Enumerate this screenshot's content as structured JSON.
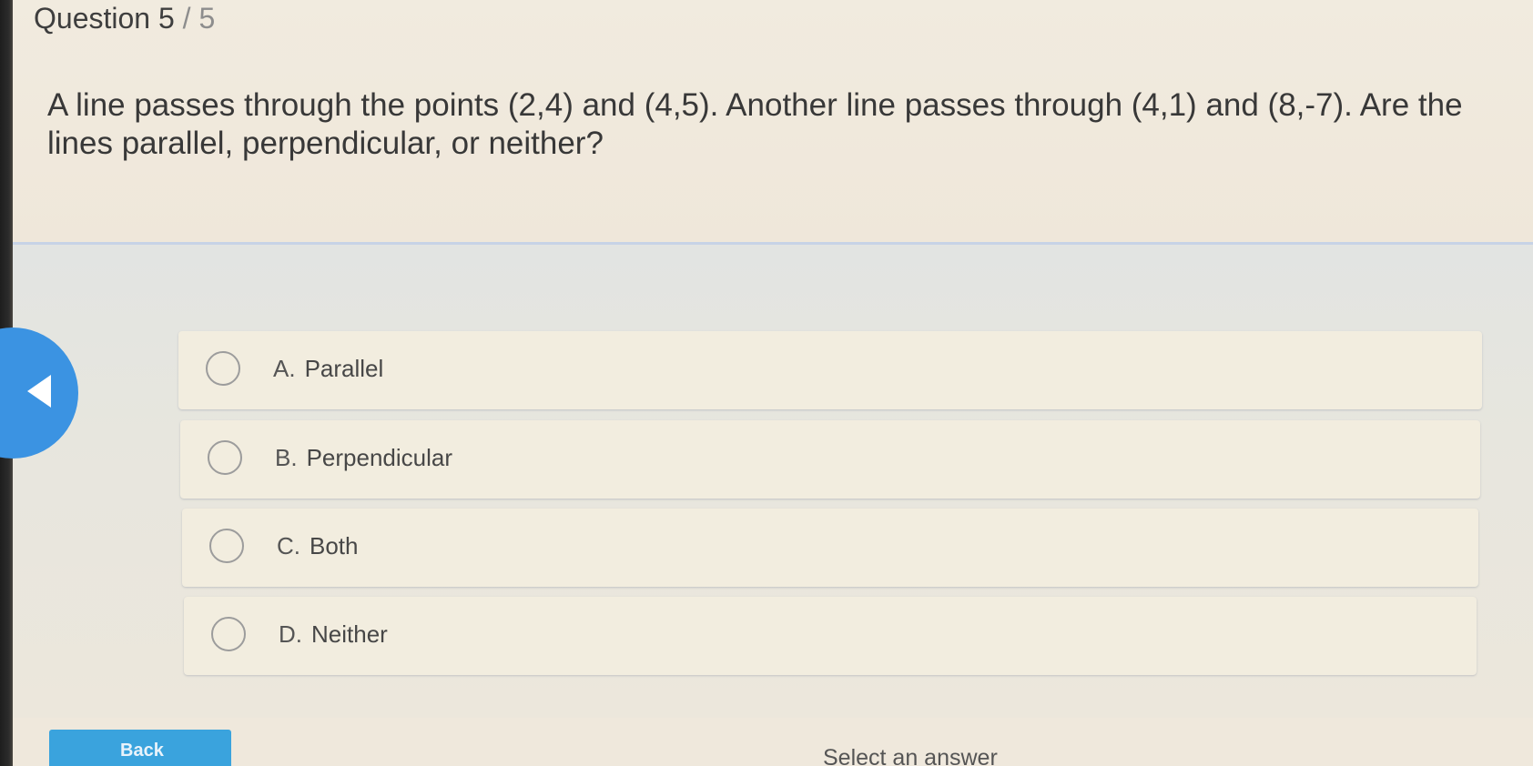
{
  "header": {
    "question_label": "Question",
    "question_number": "5",
    "separator": "/",
    "question_total": "5"
  },
  "question": {
    "text": "A line passes through the points (2,4) and (4,5). Another line passes through (4,1) and (8,-7). Are the lines parallel, perpendicular, or neither?"
  },
  "options": [
    {
      "letter": "A.",
      "label": "Parallel"
    },
    {
      "letter": "B.",
      "label": "Perpendicular"
    },
    {
      "letter": "C.",
      "label": "Both"
    },
    {
      "letter": "D.",
      "label": "Neither"
    }
  ],
  "footer": {
    "back_label": "Back",
    "status_text": "Select an answer"
  },
  "colors": {
    "accent_blue": "#3b93e2",
    "back_button": "#3aa3dd",
    "option_bg": "#f2eddf",
    "page_bg": "#efe9dd"
  },
  "icons": {
    "prev": "left-triangle-icon",
    "radio": "radio-circle-icon"
  }
}
